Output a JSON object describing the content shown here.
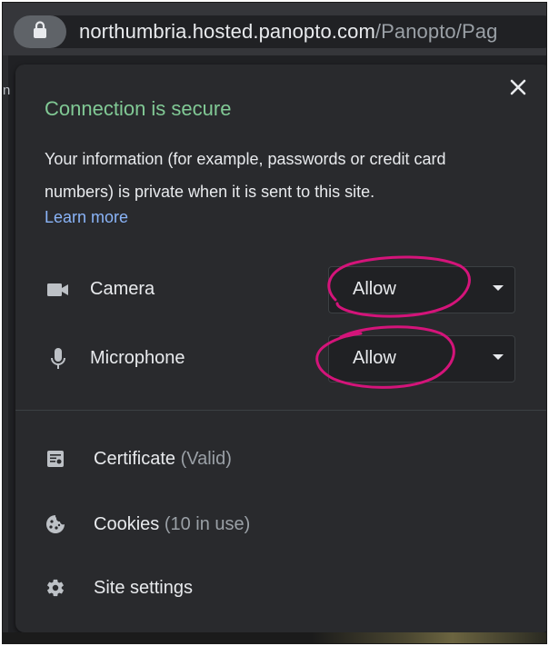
{
  "address_bar": {
    "host": "northumbria.hosted.panopto.com",
    "path": "/Panopto/Pag",
    "icon": "lock-icon"
  },
  "left_sliver_char": "n",
  "popup": {
    "close_icon": "close-icon",
    "title": "Connection is secure",
    "description": "Your information (for example, passwords or credit card numbers) is private when it is sent to this site.",
    "learn_more": "Learn more",
    "permissions": [
      {
        "label": "Camera",
        "value": "Allow",
        "icon": "camera-icon"
      },
      {
        "label": "Microphone",
        "value": "Allow",
        "icon": "microphone-icon"
      }
    ],
    "site_items": {
      "certificate": {
        "label": "Certificate",
        "sub": "(Valid)",
        "icon": "certificate-icon"
      },
      "cookies": {
        "label": "Cookies",
        "sub": "(10 in use)",
        "icon": "cookie-icon"
      },
      "site_settings": {
        "label": "Site settings",
        "icon": "gear-icon"
      }
    }
  },
  "colors": {
    "title_green": "#81c995",
    "link_blue": "#8ab4f8",
    "annotation_pink": "#d4147a",
    "popup_bg": "#292a2d"
  }
}
